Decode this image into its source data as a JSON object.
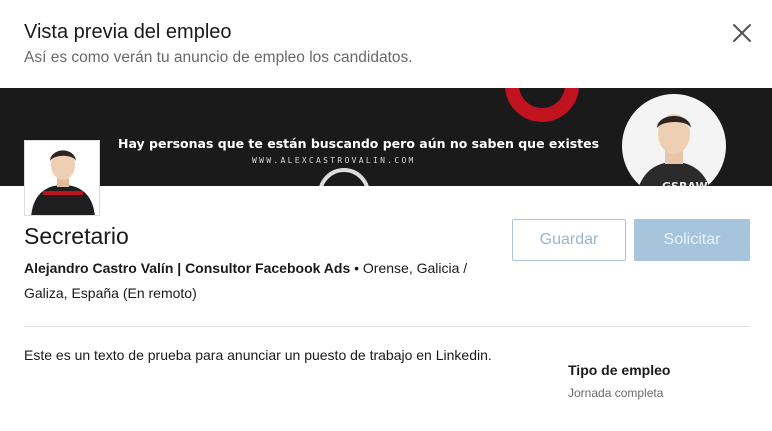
{
  "modal": {
    "title": "Vista previa del empleo",
    "subtitle": "Así es como verán tu anuncio de empleo los candidatos."
  },
  "banner": {
    "headline": "Hay personas que te están buscando pero aún no saben que existes",
    "url": "WWW.ALEXCASTROVALIN.COM",
    "accent_color": "#c1121f"
  },
  "job": {
    "title": "Secretario",
    "company": "Alejandro Castro Valín | Consultor Facebook Ads",
    "separator": " • ",
    "location": "Orense, Galicia / Galiza, España (En remoto)",
    "description": "Este es un texto de prueba para anunciar un puesto de trabajo en Linkedin.",
    "employment_type_label": "Tipo de empleo",
    "employment_type_value": "Jornada completa"
  },
  "actions": {
    "save_label": "Guardar",
    "apply_label": "Solicitar"
  },
  "icons": {
    "close": "close-icon"
  }
}
